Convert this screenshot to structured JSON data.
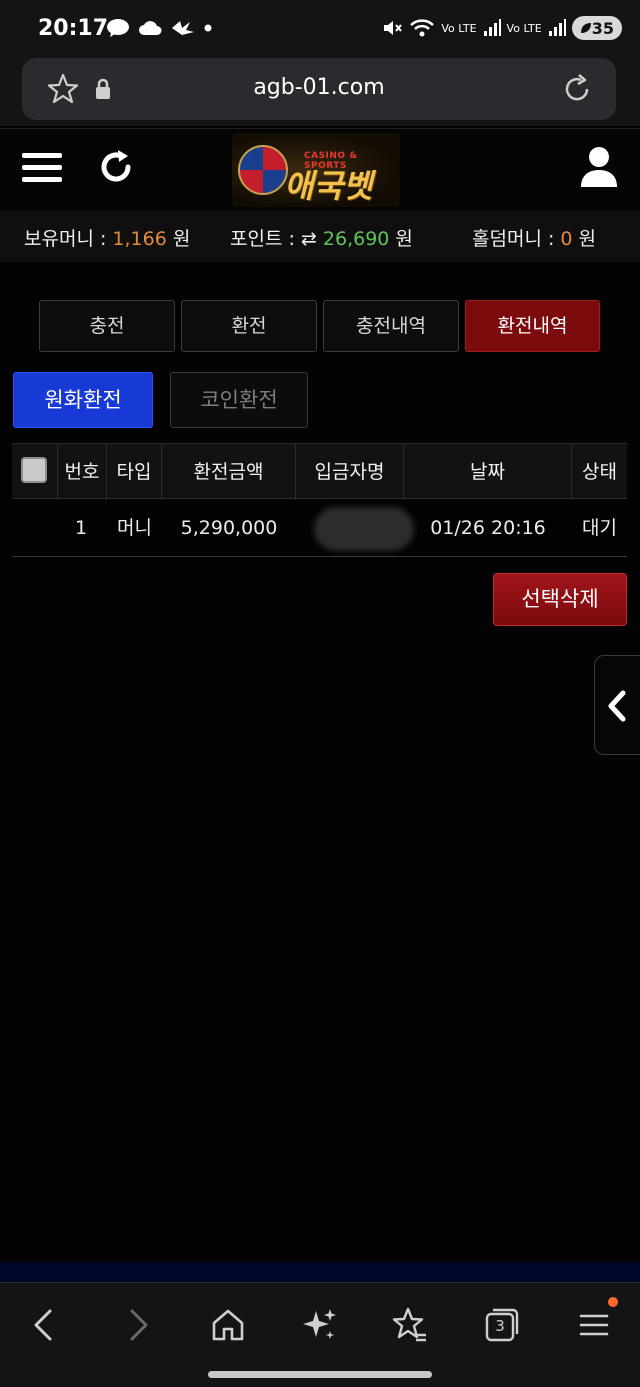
{
  "status_bar": {
    "time": "20:17",
    "battery": "35",
    "network_label_1": "Vo LTE",
    "network_label_2": "Vo LTE"
  },
  "browser": {
    "url": "agb-01.com"
  },
  "header": {
    "logo_tagline": "CASINO & SPORTS",
    "logo_name": "애국벳",
    "logo_badge": "Korea"
  },
  "money": {
    "holding_label": "보유머니 : ",
    "holding_value": "1,166",
    "holding_unit": " 원",
    "point_label": "포인트 : ",
    "point_icon": "⇄",
    "point_value": "26,690",
    "point_unit": " 원",
    "holdem_label": "홀덤머니 : ",
    "holdem_value": "0",
    "holdem_unit": " 원"
  },
  "tabs": [
    {
      "label": "충전"
    },
    {
      "label": "환전"
    },
    {
      "label": "충전내역"
    },
    {
      "label": "환전내역"
    }
  ],
  "sub_tabs": [
    {
      "label": "원화환전"
    },
    {
      "label": "코인환전"
    }
  ],
  "table": {
    "headers": [
      "번호",
      "타입",
      "환전금액",
      "입금자명",
      "날짜",
      "상태"
    ],
    "rows": [
      {
        "no": "1",
        "type": "머니",
        "amount": "5,290,000",
        "date": "01/26 20:16",
        "status": "대기"
      }
    ]
  },
  "actions": {
    "delete_selected": "선택삭제"
  },
  "colors": {
    "active_tab": "#7b0b0d",
    "active_subtab": "#1739d6",
    "holding_value": "#e58a3a",
    "point_value": "#5fc45a"
  },
  "bottom_nav": {
    "tab_count": "3"
  }
}
